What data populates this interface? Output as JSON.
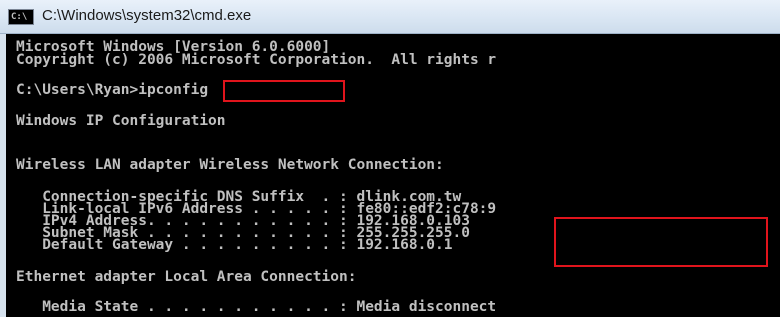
{
  "window": {
    "title": "C:\\Windows\\system32\\cmd.exe",
    "icon_label": "C:\\"
  },
  "console": {
    "lines": [
      "Microsoft Windows [Version 6.0.6000]",
      "Copyright (c) 2006 Microsoft Corporation.  All rights r",
      "",
      "C:\\Users\\Ryan>ipconfig",
      "",
      "Windows IP Configuration",
      "",
      "",
      "Wireless LAN adapter Wireless Network Connection:",
      "",
      "   Connection-specific DNS Suffix  . : dlink.com.tw",
      "   Link-local IPv6 Address . . . . . : fe80::edf2:c78:9",
      "   IPv4 Address. . . . . . . . . . . : 192.168.0.103",
      "   Subnet Mask . . . . . . . . . . . : 255.255.255.0",
      "   Default Gateway . . . . . . . . . : 192.168.0.1",
      "",
      "Ethernet adapter Local Area Connection:",
      "",
      "   Media State . . . . . . . . . . . : Media disconnect"
    ]
  },
  "colors": {
    "console_bg": "#000000",
    "console_text": "#c0c0c0",
    "highlight": "#e0141c"
  }
}
